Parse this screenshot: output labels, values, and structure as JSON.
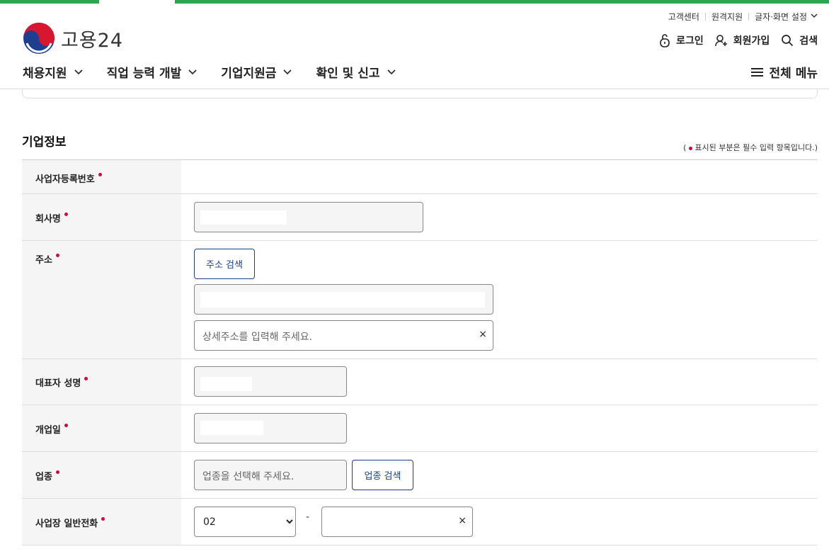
{
  "header": {
    "util_links": [
      "고객센터",
      "원격지원",
      "글자·화면 설정"
    ],
    "logo_text": "고용24",
    "account": {
      "login": "로그인",
      "signup": "회원가입",
      "search": "검색"
    },
    "gnb": [
      "채용지원",
      "직업 능력 개발",
      "기업지원금",
      "확인 및 신고"
    ],
    "all_menu": "전체 메뉴"
  },
  "section": {
    "title": "기업정보",
    "required_note_pre": "(",
    "required_note": "표시된 부분은 필수 입력 항목입니다.)"
  },
  "form": {
    "business_no_label": "사업자등록번호",
    "company_label": "회사명",
    "address_label": "주소",
    "address_search_btn": "주소 검색",
    "address_detail_placeholder": "상세주소를 입력해 주세요.",
    "ceo_label": "대표자 성명",
    "open_date_label": "개업일",
    "industry_label": "업종",
    "industry_placeholder": "업종을 선택해 주세요.",
    "industry_search_btn": "업종 검색",
    "phone_label": "사업장 일반전화",
    "phone_area": "02",
    "phone_dash": "-",
    "clear_symbol": "×"
  },
  "colors": {
    "accent_green": "#2ea44f",
    "required_dot": "#d6004c",
    "button_blue": "#1d3e8a"
  }
}
